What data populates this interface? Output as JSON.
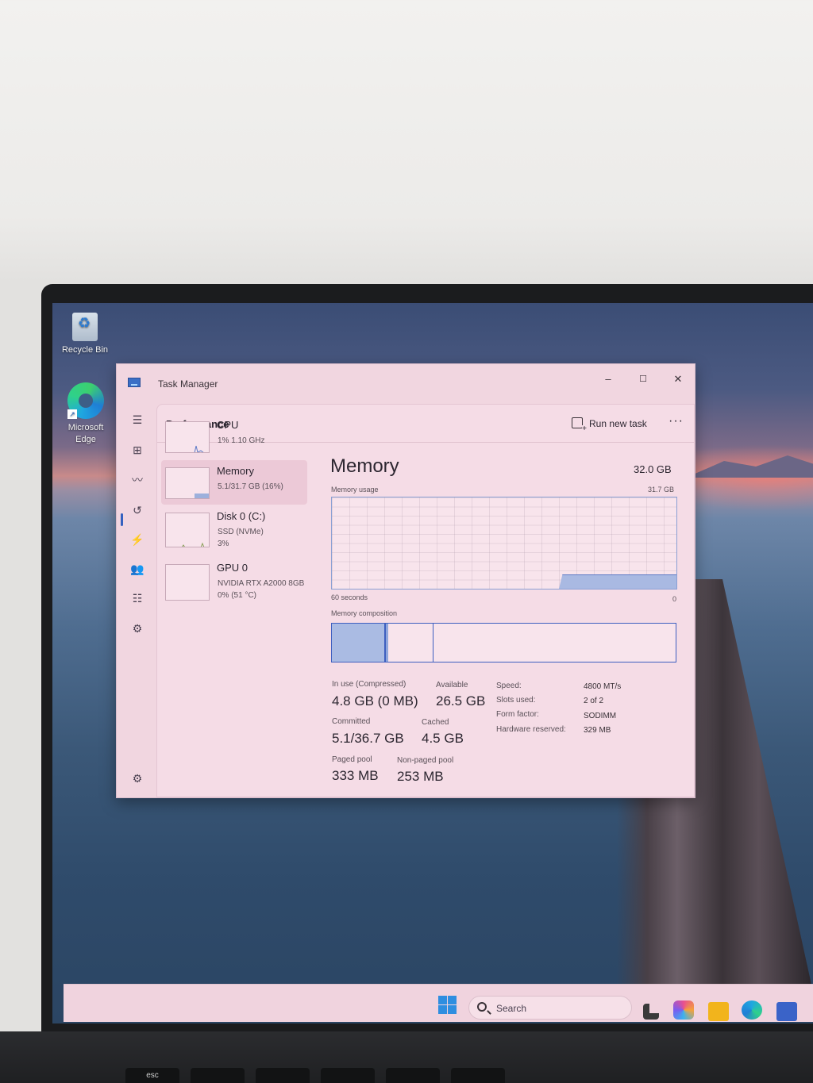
{
  "desktop": {
    "icons": [
      {
        "label": "Recycle Bin"
      },
      {
        "label": "Microsoft Edge"
      }
    ]
  },
  "window": {
    "title": "Task Manager",
    "controls": {
      "minimize": "–",
      "maximize": "☐",
      "close": "✕"
    },
    "section_title": "Performance",
    "run_new_task_label": "Run new task",
    "more_label": "···"
  },
  "nav": [
    {
      "name": "hamburger-menu-icon",
      "glyph": "☰"
    },
    {
      "name": "processes-icon",
      "glyph": "⊞"
    },
    {
      "name": "performance-icon",
      "glyph": "〰"
    },
    {
      "name": "app-history-icon",
      "glyph": "↺"
    },
    {
      "name": "startup-apps-icon",
      "glyph": "⚡"
    },
    {
      "name": "users-icon",
      "glyph": "👥"
    },
    {
      "name": "details-icon",
      "glyph": "☷"
    },
    {
      "name": "services-icon",
      "glyph": "⚙"
    }
  ],
  "settings_glyph": "⚙",
  "devices": [
    {
      "name": "CPU",
      "sub1": "1%  1.10 GHz",
      "sub2": ""
    },
    {
      "name": "Memory",
      "sub1": "5.1/31.7 GB (16%)",
      "sub2": ""
    },
    {
      "name": "Disk 0 (C:)",
      "sub1": "SSD (NVMe)",
      "sub2": "3%"
    },
    {
      "name": "GPU 0",
      "sub1": "NVIDIA RTX A2000 8GB",
      "sub2": "0%  (51 °C)"
    }
  ],
  "memory": {
    "title": "Memory",
    "total": "32.0 GB",
    "usage_label": "Memory usage",
    "usage_max": "31.7 GB",
    "time_label": "60 seconds",
    "time_end": "0",
    "composition_label": "Memory composition",
    "usage_fraction": 0.16,
    "stats": {
      "in_use_label": "In use (Compressed)",
      "in_use_value": "4.8 GB (0 MB)",
      "available_label": "Available",
      "available_value": "26.5 GB",
      "committed_label": "Committed",
      "committed_value": "5.1/36.7 GB",
      "cached_label": "Cached",
      "cached_value": "4.5 GB",
      "paged_label": "Paged pool",
      "paged_value": "333 MB",
      "nonpaged_label": "Non-paged pool",
      "nonpaged_value": "253 MB"
    },
    "details": [
      {
        "label": "Speed:",
        "value": "4800 MT/s"
      },
      {
        "label": "Slots used:",
        "value": "2 of 2"
      },
      {
        "label": "Form factor:",
        "value": "SODIMM"
      },
      {
        "label": "Hardware reserved:",
        "value": "329 MB"
      }
    ]
  },
  "taskbar": {
    "search_placeholder": "Search",
    "apps": [
      "task-view-icon",
      "copilot-icon",
      "file-explorer-icon",
      "edge-taskbar-icon",
      "store-icon"
    ]
  },
  "keyboard": {
    "keys": [
      "esc",
      "",
      "",
      "",
      "",
      ""
    ]
  },
  "colors": {
    "accent": "#3e5fc0",
    "window_bg": "#f1d6e0",
    "graph_fill": "#a9b9e2"
  }
}
